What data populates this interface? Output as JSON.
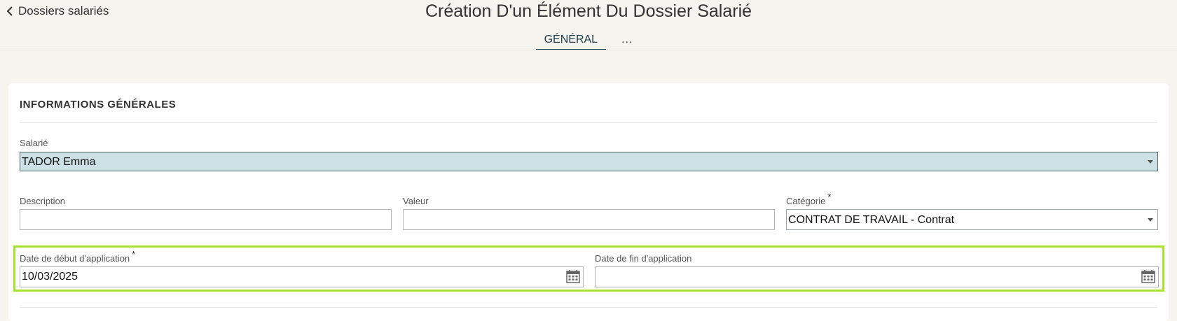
{
  "header": {
    "back_label": "Dossiers salariés",
    "title": "Création D'un Élément Du Dossier Salarié"
  },
  "tabs": [
    {
      "label": "GÉNÉRAL",
      "active": true
    },
    {
      "label": "..."
    }
  ],
  "section": {
    "title": "INFORMATIONS GÉNÉRALES"
  },
  "fields": {
    "salarie": {
      "label": "Salarié",
      "value": "TADOR Emma"
    },
    "description": {
      "label": "Description",
      "value": ""
    },
    "valeur": {
      "label": "Valeur",
      "value": ""
    },
    "categorie": {
      "label": "Catégorie",
      "required_mark": "*",
      "value": "CONTRAT DE TRAVAIL - Contrat"
    },
    "date_debut": {
      "label": "Date de début d'application",
      "required_mark": "*",
      "value": "10/03/2025"
    },
    "date_fin": {
      "label": "Date de fin d'application",
      "value": ""
    }
  },
  "icons": {
    "back": "chevron-left-icon",
    "dropdown": "caret-down-icon",
    "calendar": "calendar-icon"
  },
  "colors": {
    "highlight": "#a6e22e",
    "selected_field": "#cde0e6",
    "tab_active": "#1b3b47"
  }
}
